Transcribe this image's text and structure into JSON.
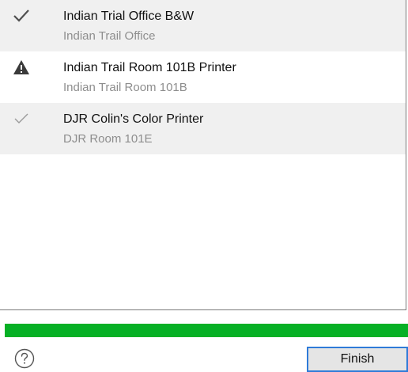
{
  "printers": [
    {
      "name": "Indian Trial Office B&W",
      "location": "Indian Trail Office",
      "status_icon": "checkmark-icon",
      "status_color": "#505050"
    },
    {
      "name": "Indian Trail Room 101B Printer",
      "location": "Indian Trail Room 101B",
      "status_icon": "warning-icon",
      "status_color": "#3a3a3a"
    },
    {
      "name": "DJR Colin's Color Printer",
      "location": "DJR Room 101E",
      "status_icon": "checkmark-icon",
      "status_color": "#9a9a9a"
    }
  ],
  "progress": {
    "fraction": 1.0,
    "color": "#06b025"
  },
  "footer": {
    "help_icon": "help-icon",
    "finish_label": "Finish"
  }
}
